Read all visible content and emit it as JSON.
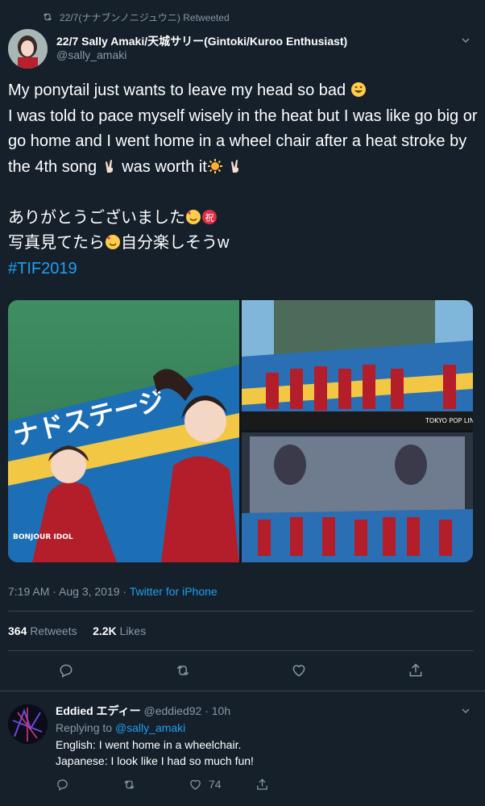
{
  "retweet_banner": "22/7(ナナブンノニジュウニ) Retweeted",
  "tweet": {
    "author_display_name": "22/7 Sally Amaki/天城サリー(Gintoki/Kuroo Enthusiast)",
    "author_handle": "@sally_amaki",
    "text_line1": "My ponytail just wants to leave my head so bad ",
    "text_line2": "I was told to pace myself wisely in the heat but I was like go big or go home and I went home in a wheel chair after a heat stroke by the 4th song ",
    "text_line2b": " was worth it",
    "text_line3": "ありがとうございました",
    "text_line4a": "写真見てたら",
    "text_line4b": "自分楽しそうw",
    "hashtag": "#TIF2019",
    "time": "7:19 AM · Aug 3, 2019 · ",
    "source": "Twitter for iPhone",
    "retweets_count": "364",
    "retweets_label": "Retweets",
    "likes_count": "2.2K",
    "likes_label": "Likes",
    "media": {
      "main_overlay_text": "ナドステージ",
      "main_logo": "BONJOUR IDOL",
      "top_right_watermark": "TOKYO POP LINE"
    }
  },
  "reply": {
    "author_display_name": "Eddied エディー",
    "author_handle": "@eddied92",
    "time": "10h",
    "replying_to_label": "Replying to ",
    "replying_to_handle": "@sally_amaki",
    "body": "English: I went home in a wheelchair.\nJapanese: I look like I had so much fun!",
    "likes_count": "74"
  },
  "colors": {
    "background": "#15202b",
    "muted_text": "#8899a6",
    "link": "#1da1f2",
    "divider": "#38444d"
  }
}
